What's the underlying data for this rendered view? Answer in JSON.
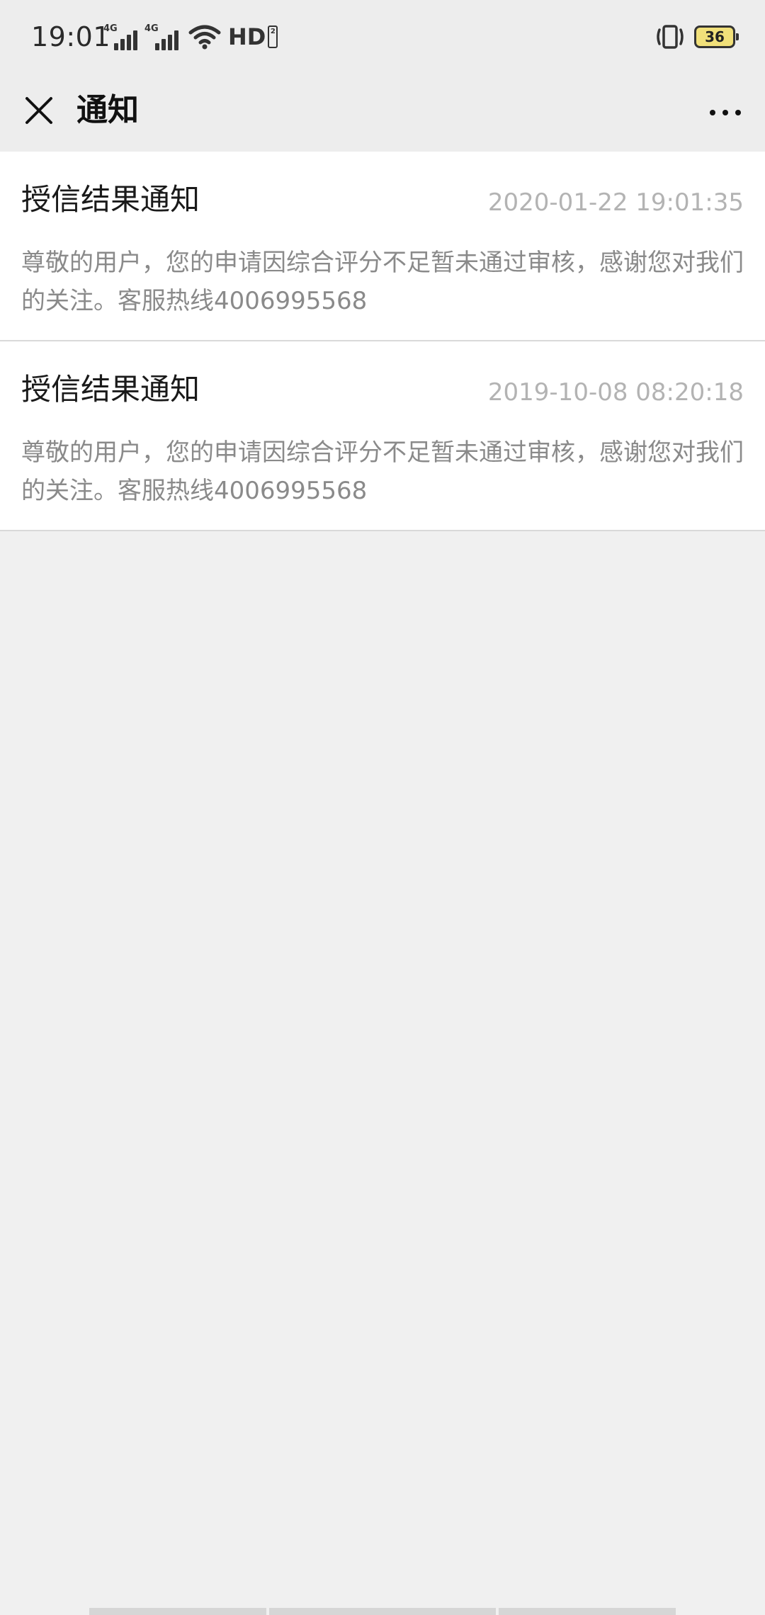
{
  "status_bar": {
    "time": "19:01",
    "sim1_tag": "4G",
    "sim2_tag": "4G",
    "hd_label": "HD",
    "hd_sub": "2",
    "battery_level": "36"
  },
  "header": {
    "title": "通知"
  },
  "notifications": [
    {
      "title": "授信结果通知",
      "time": "2020-01-22 19:01:35",
      "body": "尊敬的用户，您的申请因综合评分不足暂未通过审核，感谢您对我们的关注。客服热线4006995568"
    },
    {
      "title": "授信结果通知",
      "time": "2019-10-08 08:20:18",
      "body": "尊敬的用户，您的申请因综合评分不足暂未通过审核，感谢您对我们的关注。客服热线4006995568"
    }
  ],
  "colors": {
    "header_bg": "#ededed",
    "page_bg": "#f0f0f0",
    "card_bg": "#ffffff",
    "title_text": "#1a1a1a",
    "time_text": "#b3b3b3",
    "body_text": "#8a8a8a",
    "battery_fill": "#f1e07a"
  }
}
